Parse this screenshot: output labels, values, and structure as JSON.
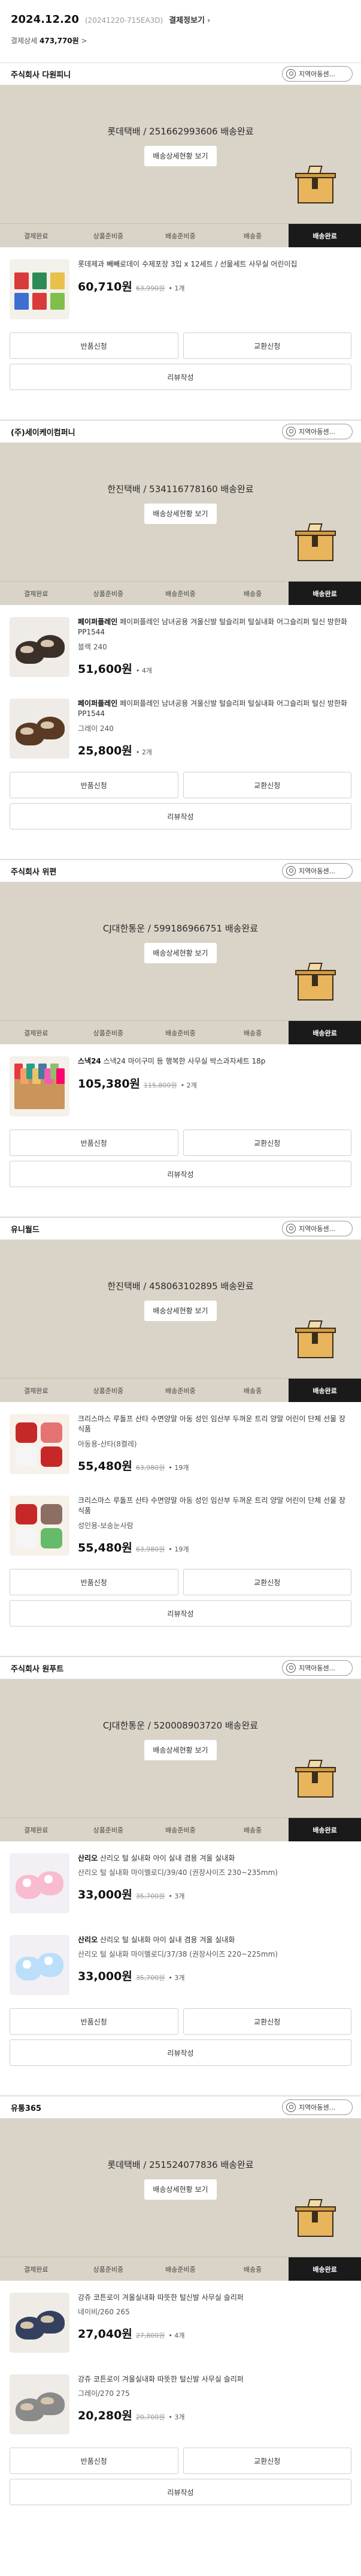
{
  "order": {
    "date": "2024.12.20",
    "number": "(20241220-715EA3D)",
    "detail_link": "결제정보기",
    "total_label": "결제상세",
    "total_value": "473,770원",
    "total_arrow": ">"
  },
  "labels": {
    "region_btn": "지역아동센...",
    "track_btn": "배송상세현황 보기",
    "steps": [
      "결제완료",
      "상품준비중",
      "배송준비중",
      "배송중",
      "배송완료"
    ],
    "return_btn": "반품신청",
    "exchange_btn": "교환신청",
    "review_btn": "리뷰작성"
  },
  "groups": [
    {
      "seller": "주식회사 다원피니",
      "tracking": "롯데택배 / 251662993606 배송완료",
      "items": [
        {
          "brand": "",
          "name": "롯데제과 빼빼로데이 수제포장 3입 x 12세트 / 선물세트 사무실 어린이집",
          "option": "",
          "price": "60,710원",
          "orig": "63,990원",
          "qty": "1개",
          "thumb": "snack"
        }
      ]
    },
    {
      "seller": "(주)세이케이컴퍼니",
      "tracking": "한진택배 / 534116778160 배송완료",
      "items": [
        {
          "brand": "페이퍼플레인",
          "name": " 페이퍼플레인 남녀공용 겨울신발 털슬리퍼 털실내화 어그슬리퍼 털신 방한화 PP1544",
          "option": "블랙 240",
          "price": "51,600원",
          "orig": "",
          "qty": "4개",
          "thumb": "slipper-dark"
        },
        {
          "brand": "페이퍼플레인",
          "name": " 페이퍼플레인 남녀공용 겨울신발 털슬리퍼 털실내화 어그슬리퍼 털신 방한화 PP1544",
          "option": "그레이 240",
          "price": "25,800원",
          "orig": "",
          "qty": "2개",
          "thumb": "slipper-brown"
        }
      ]
    },
    {
      "seller": "주식회사 위편",
      "tracking": "CJ대한통운 / 599186966751 배송완료",
      "items": [
        {
          "brand": "스낵24",
          "name": " 스낵24 마이구미 등 행복한 사무실 박스과자세트 18p",
          "option": "",
          "price": "105,380원",
          "orig": "115,800원",
          "qty": "2개",
          "thumb": "snackbox"
        }
      ]
    },
    {
      "seller": "유니월드",
      "tracking": "한진택배 / 458063102895 배송완료",
      "items": [
        {
          "brand": "",
          "name": "크리스마스 루돌프 산타 수면양말 아동 성인 임산부 두꺼운 트리 양말 어린이 단체 선물 장식품",
          "option": "아동용-산타(8켤레)",
          "price": "55,480원",
          "orig": "63,980원",
          "qty": "19개",
          "thumb": "gift-red"
        },
        {
          "brand": "",
          "name": "크리스마스 루돌프 산타 수면양말 아동 성인 임산부 두꺼운 트리 양말 어린이 단체 선물 장식품",
          "option": "성인용-보송눈사람",
          "price": "55,480원",
          "orig": "63,980원",
          "qty": "19개",
          "thumb": "gift-mix"
        }
      ]
    },
    {
      "seller": "주식회사 원푸트",
      "tracking": "CJ대한통운 / 520008903720 배송완료",
      "items": [
        {
          "brand": "산리오",
          "name": " 산리오 털 실내화 아이 실내 겸용 겨울 실내화",
          "option": "산리오 털 실내화 마이멜로디/39/40 (권장사이즈 230~235mm)",
          "price": "33,000원",
          "orig": "35,700원",
          "qty": "3개",
          "thumb": "kids-pink"
        },
        {
          "brand": "산리오",
          "name": " 산리오 털 실내화 아이 실내 겸용 겨울 실내화",
          "option": "산리오 털 실내화 마이멜로디/37/38 (권장사이즈 220~225mm)",
          "price": "33,000원",
          "orig": "35,700원",
          "qty": "3개",
          "thumb": "kids-blue"
        }
      ]
    },
    {
      "seller": "유통365",
      "tracking": "롯데택배 / 251524077836 배송완료",
      "items": [
        {
          "brand": "",
          "name": "강쥬 코튼로이 겨울실내화 따뜻한 털신발 사무실 슬리퍼",
          "option": "네이비/260 265",
          "price": "27,040원",
          "orig": "27,800원",
          "qty": "4개",
          "thumb": "slipper-navy"
        },
        {
          "brand": "",
          "name": "강쥬 코튼로이 겨울실내화 따뜻한 털신발 사무실 슬리퍼",
          "option": "그레이/270 275",
          "price": "20,280원",
          "orig": "20,700원",
          "qty": "3개",
          "thumb": "slipper-grey"
        }
      ]
    }
  ]
}
